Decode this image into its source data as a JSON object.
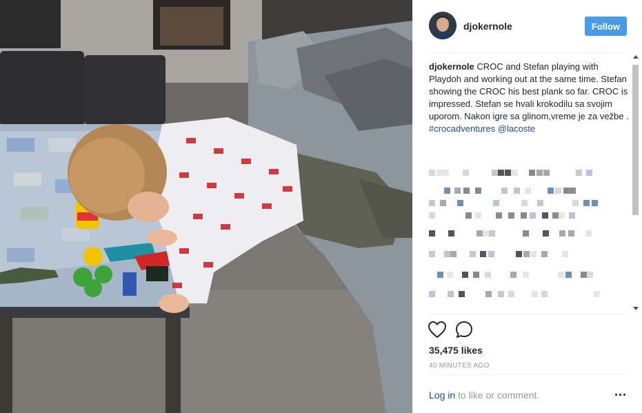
{
  "post": {
    "username": "djokernole",
    "follow_label": "Follow",
    "caption": {
      "author": "djokernole",
      "text": " CROC and Stefan playing with Playdoh and working out at the same time. Stefan showing the CROC his best plank so far. CROC is impressed. Stefan se hvali krokodilu sa svojim uporom. Nakon igre sa glinom,vreme je za vežbe . ",
      "hashtag": "#crocadventures",
      "mention": "@lacoste"
    },
    "likes": "35,475 likes",
    "timestamp": "40 MINUTES AGO",
    "login_link": "Log in",
    "login_rest": " to like or comment."
  },
  "icons": {
    "like": "heart-outline-icon",
    "comment": "speech-bubble-icon",
    "more": "ellipsis-icon",
    "avatar": "profile-photo"
  },
  "colors": {
    "follow_button": "#4a9ae6",
    "link": "#1d4f86",
    "muted_text": "#999999",
    "divider": "#efefef"
  }
}
